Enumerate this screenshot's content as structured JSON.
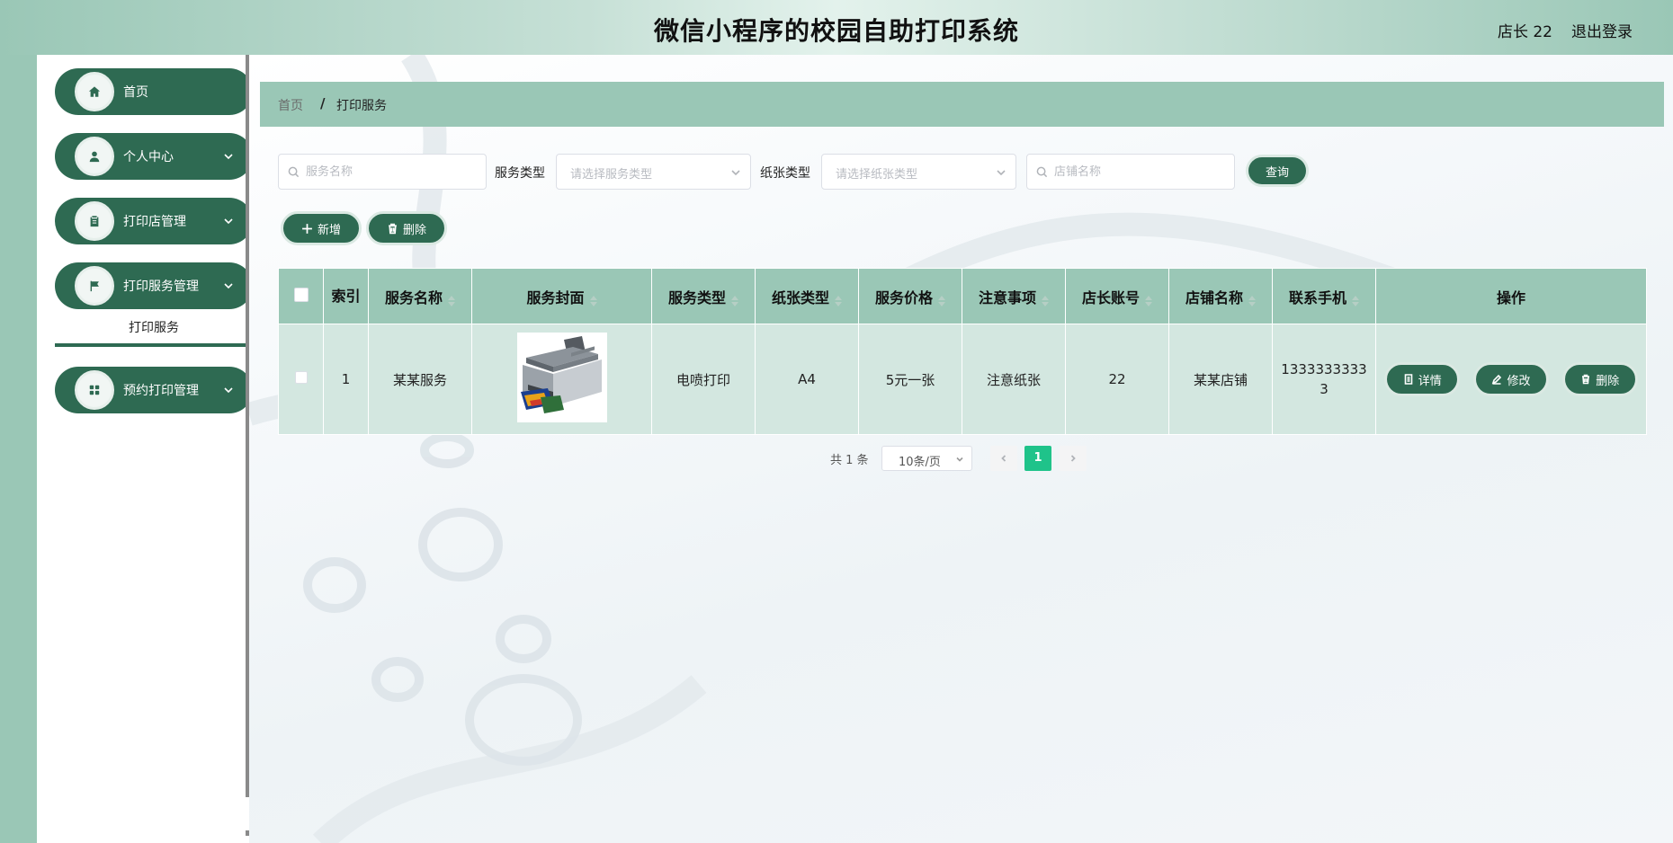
{
  "header": {
    "title": "微信小程序的校园自助打印系统",
    "user": "店长 22",
    "logout": "退出登录"
  },
  "sidebar": {
    "items": [
      {
        "label": "首页",
        "icon": "home-icon"
      },
      {
        "label": "个人中心",
        "icon": "user-icon"
      },
      {
        "label": "打印店管理",
        "icon": "clipboard-icon"
      },
      {
        "label": "打印服务管理",
        "icon": "flag-icon"
      },
      {
        "label": "预约打印管理",
        "icon": "grid-icon"
      }
    ],
    "submenu_active": "打印服务"
  },
  "breadcrumb": {
    "home": "首页",
    "separator": "/",
    "current": "打印服务"
  },
  "search": {
    "service_name_placeholder": "服务名称",
    "service_type_label": "服务类型",
    "service_type_placeholder": "请选择服务类型",
    "paper_type_label": "纸张类型",
    "paper_type_placeholder": "请选择纸张类型",
    "shop_name_placeholder": "店铺名称",
    "query_button": "查询"
  },
  "actions": {
    "add": "新增",
    "delete": "删除"
  },
  "table": {
    "headers": [
      "索引",
      "服务名称",
      "服务封面",
      "服务类型",
      "纸张类型",
      "服务价格",
      "注意事项",
      "店长账号",
      "店铺名称",
      "联系手机",
      "操作"
    ],
    "rows": [
      {
        "index": "1",
        "service_name": "某某服务",
        "cover": "printer-image",
        "service_type": "电喷打印",
        "paper_type": "A4",
        "price": "5元一张",
        "notes": "注意纸张",
        "manager_account": "22",
        "shop_name": "某某店铺",
        "phone": "13333333333",
        "btn_detail": "详情",
        "btn_edit": "修改",
        "btn_delete": "删除"
      }
    ]
  },
  "pagination": {
    "total": "共 1 条",
    "page_size": "10条/页",
    "current_page": "1"
  },
  "colors": {
    "primary_dark": "#2e6a52",
    "primary_light": "#9ac7b6",
    "row_bg": "#d3e7e0",
    "page_active": "#1fc38a"
  }
}
